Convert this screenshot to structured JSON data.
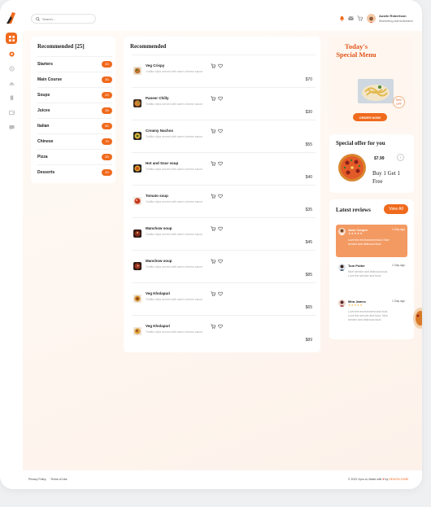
{
  "search": {
    "placeholder": "Search..."
  },
  "user": {
    "name": "Austin Robertson",
    "role": "Marketing Administrator"
  },
  "categories": {
    "title": "Recommended [25]",
    "items": [
      {
        "label": "Starters",
        "count": "20"
      },
      {
        "label": "Main Course",
        "count": "30"
      },
      {
        "label": "Soups",
        "count": "20"
      },
      {
        "label": "Juices",
        "count": "35"
      },
      {
        "label": "Italian",
        "count": "50"
      },
      {
        "label": "Chinese",
        "count": "70"
      },
      {
        "label": "Pizza",
        "count": "30"
      },
      {
        "label": "Desserts",
        "count": "20"
      }
    ]
  },
  "recommended": {
    "title": "Recommended",
    "items": [
      {
        "name": "Veg Crispy",
        "desc": "Tortilla chips served with warm cheese sauce",
        "price": "$70"
      },
      {
        "name": "Paneer Chilly",
        "desc": "Tortilla chips served with warm cheese sauce",
        "price": "$30"
      },
      {
        "name": "Creamy Nachos",
        "desc": "Tortilla chips served with warm cheese sauce",
        "price": "$55"
      },
      {
        "name": "Hot and Sour soup",
        "desc": "Tortilla chips served with warm cheese sauce",
        "price": "$40"
      },
      {
        "name": "Tomato soup",
        "desc": "Tortilla chips served with warm cheese sauce",
        "price": "$35"
      },
      {
        "name": "Manchow soup",
        "desc": "Tortilla chips served with warm cheese sauce",
        "price": "$45"
      },
      {
        "name": "Manchow soup",
        "desc": "Tortilla chips served with warm cheese sauce",
        "price": "$85"
      },
      {
        "name": "Veg Kholapuri",
        "desc": "Tortilla chips served with warm cheese sauce",
        "price": "$65"
      },
      {
        "name": "Veg Kholapuri",
        "desc": "Tortilla chips served with warm cheese sauce",
        "price": "$89"
      }
    ]
  },
  "promo": {
    "title": "Today's Special Menu",
    "badge_line1": "50%",
    "badge_line2": "OFF",
    "button": "ORDER NOW!"
  },
  "offer": {
    "title": "Special offer for you",
    "price": "$7.99",
    "deal": "Buy 1 Get 1 Free",
    "next": "›"
  },
  "reviews": {
    "title": "Latest reviews",
    "view_all": "View All",
    "items": [
      {
        "name": "Jane Cooper",
        "stars": "★★★★★",
        "time": "1 Day ago",
        "text": "Love the environment food. Nice service and delicious food."
      },
      {
        "name": "Tom Potter",
        "stars": "★★★★★",
        "time": "1 Day ago",
        "text": "Nice service and delicious food. Love the service and food."
      },
      {
        "name": "Mira James",
        "stars": "★★★★★",
        "time": "1 Day ago",
        "text": "Love the environment and food. Love the service and food. Nice service and delicious food."
      }
    ]
  },
  "footer": {
    "privacy": "Privacy Policy",
    "terms": "Terms of Use",
    "copyright": "© 2021 Xpro-ui, Made with",
    "heart": "♥",
    "by": "by",
    "brand": "DEXIGN ZONE"
  },
  "colors": {
    "accent": "#f06a1d",
    "review_highlight": "#f39a63"
  },
  "icons": {
    "rail": [
      "dashboard-icon",
      "food-order-icon",
      "settings-icon",
      "orders-icon",
      "bookmark-icon",
      "wallet-icon",
      "chat-icon"
    ],
    "top": [
      "notification-icon",
      "message-icon",
      "cart-icon"
    ]
  }
}
